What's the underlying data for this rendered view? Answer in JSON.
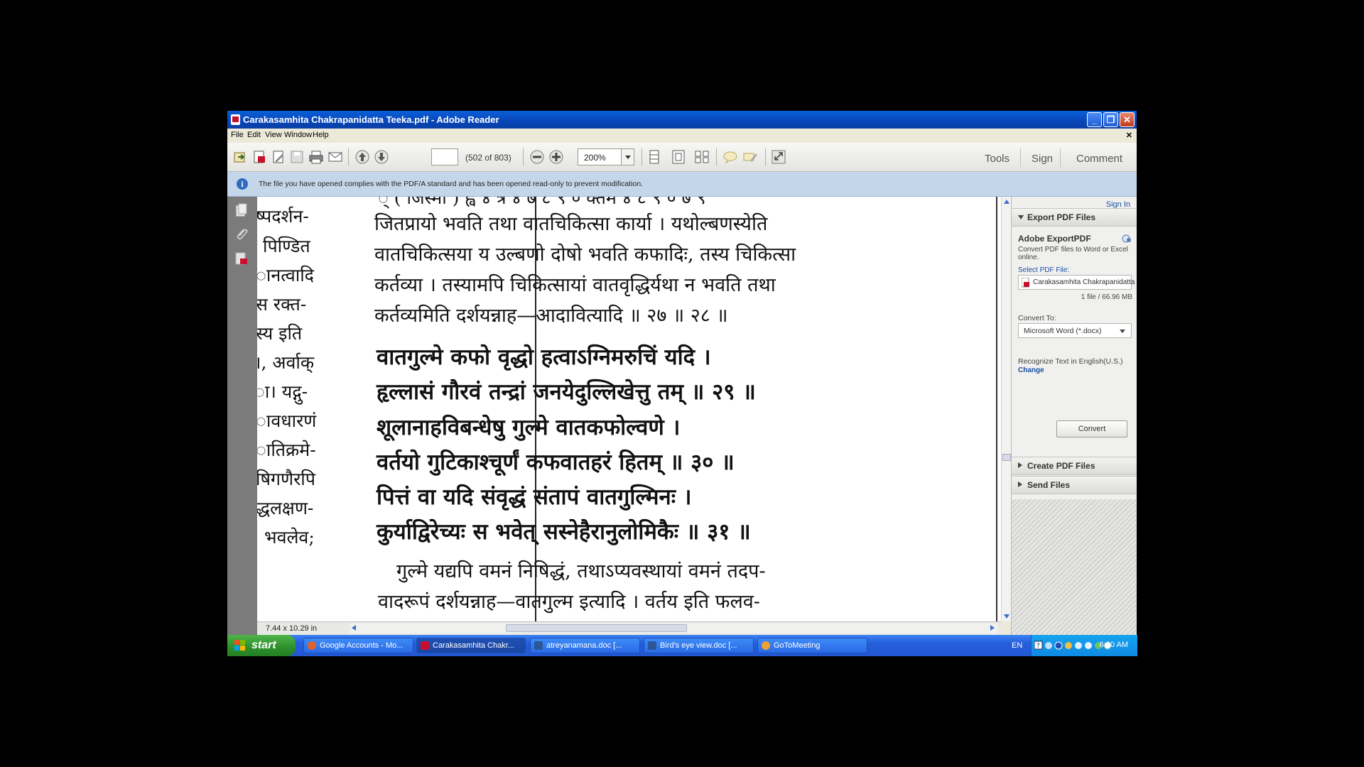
{
  "window": {
    "title": "Carakasamhita Chakrapanidatta Teeka.pdf - Adobe Reader",
    "controls": [
      "minimize",
      "restore",
      "close"
    ]
  },
  "menu": [
    "File",
    "Edit",
    "View",
    "Window",
    "Help"
  ],
  "toolbar": {
    "page_input": "",
    "page_count": "(502 of 803)",
    "zoom": "200%",
    "right_links": [
      "Tools",
      "Sign",
      "Comment"
    ]
  },
  "infobar": {
    "message": "The file you have opened complies with the PDF/A standard and has been opened read-only to prevent modification."
  },
  "document": {
    "page_size": "7.44 x 10.29 in",
    "left_column": [
      "ष्पदर्शन-",
      "पिण्डित",
      "ानत्वादि",
      "स रक्त-",
      "स्य इति",
      "।, अर्वाक्",
      "ा। यद्गु-",
      "ावधारणं",
      "ातिक्रमे-",
      "षिगणैरपि",
      "द्धलक्षण-",
      "भवलेव;"
    ],
    "commentary_top": [
      "जितप्रायो भवति तथा वातचिकित्सा कार्या । यथोल्बणस्येति",
      "वातचिकित्सया य उल्बणो दोषो भवति कफादिः, तस्य चिकित्सा",
      "कर्तव्या । तस्यामपि चिकित्सायां वातवृद्धिर्यथा न भवति तथा",
      "कर्तव्यमिति दर्शयन्नाह—आदावित्यादि ॥ २७ ॥ २८ ॥"
    ],
    "verses": [
      "वातगुल्मे कफो वृद्धो हत्वाऽग्निमरुचिं यदि ।",
      "हृल्लासं गौरवं तन्द्रां जनयेदुल्लिखेत्तु तम् ॥ २९ ॥",
      "शूलानाहविबन्धेषु गुल्मे वातकफोल्वणे ।",
      "वर्तयो गुटिकाश्चूर्णं कफवातहरं हितम् ॥ ३० ॥",
      "पित्तं वा यदि संवृद्धं संतापं वातगुल्मिनः ।",
      "कुर्याद्विरेच्यः स भवेत् सस्नेहैरानुलोमिकैः ॥ ३१ ॥"
    ],
    "commentary_bottom": [
      "गुल्मे यद्यपि वमनं निषिद्धं, तथाऽप्यवस्थायां वमनं तदप-",
      "वादरूपं दर्शयन्नाह—वातगुल्म इत्यादि । वर्तय इति फलव-"
    ]
  },
  "right_panel": {
    "sign_in": "Sign In",
    "export_section": "Export PDF Files",
    "export_title": "Adobe ExportPDF",
    "export_desc": "Convert PDF files to Word or Excel online.",
    "select_label": "Select PDF File:",
    "selected_file": "Carakasamhita Chakrapanidatta T...",
    "file_info": "1 file / 66.96 MB",
    "convert_to_label": "Convert To:",
    "convert_to_value": "Microsoft Word (*.docx)",
    "recognize_text": "Recognize Text in English(U.S.)",
    "change_link": "Change",
    "convert_button": "Convert",
    "create_section": "Create PDF Files",
    "send_section": "Send Files"
  },
  "taskbar": {
    "start": "start",
    "tasks": [
      {
        "label": "Google Accounts - Mo...",
        "icon_color": "#e2632a"
      },
      {
        "label": "Carakasamhita Chakr...",
        "icon_color": "#c8102e"
      },
      {
        "label": "atreyanamana.doc [...",
        "icon_color": "#2b5797"
      },
      {
        "label": "Bird's eye view.doc [...",
        "icon_color": "#2b5797"
      },
      {
        "label": "GoToMeeting",
        "icon_color": "#f0a030"
      }
    ],
    "language": "EN",
    "clock": "6:20 AM"
  }
}
